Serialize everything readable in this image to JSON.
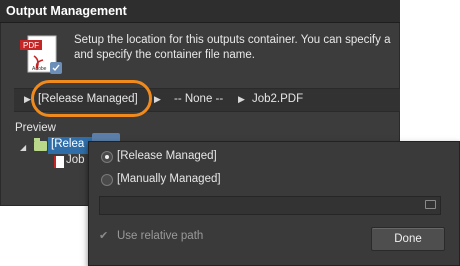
{
  "window": {
    "title": "Output Management"
  },
  "description": {
    "line1": "Setup the location for this outputs container. You can specify a",
    "line2": "and specify the container file name."
  },
  "path_bar": {
    "mode": "[Release Managed]",
    "folder": "-- None --",
    "file": "Job2.PDF"
  },
  "preview": {
    "label": "Preview",
    "root_node": "[Relea",
    "child_node": "Job"
  },
  "popup": {
    "option_release": "[Release Managed]",
    "option_manual": "[Manually Managed]",
    "selected_option": "[Release Managed]",
    "path_value": "",
    "relative_checkbox_label": "Use relative path",
    "relative_checked": true,
    "done_label": "Done"
  },
  "icons": {
    "pdf_badge_text": "PDF",
    "pdf_brand_text": "Adobe"
  },
  "colors": {
    "highlight": "#f08a1c",
    "selection": "#2f6ea8",
    "panel_bg": "#3c3c3c"
  }
}
